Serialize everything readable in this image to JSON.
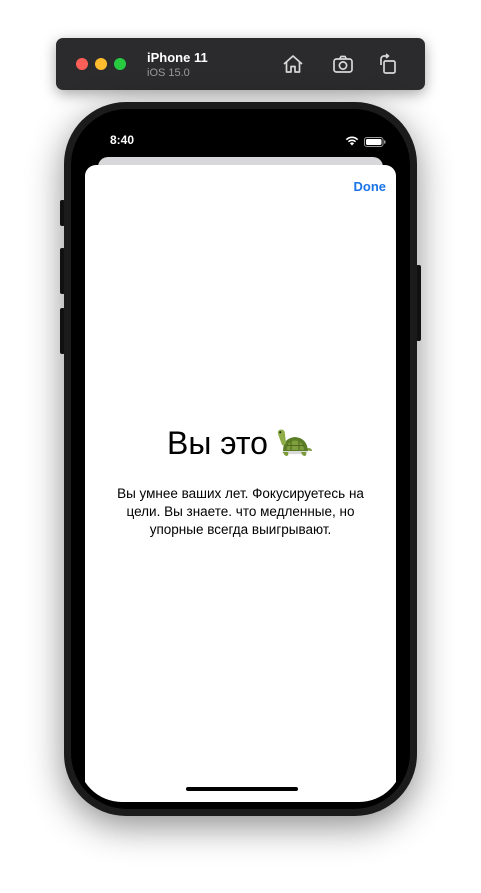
{
  "simulator": {
    "device_name": "iPhone 11",
    "os_version": "iOS 15.0",
    "toolbar_icons": [
      "home-icon",
      "screenshot-icon",
      "rotate-icon"
    ]
  },
  "status_bar": {
    "time": "8:40",
    "icons": [
      "wifi-icon",
      "battery-icon"
    ]
  },
  "sheet": {
    "done_label": "Done",
    "title": "Вы это",
    "title_icon": "turtle-icon",
    "description": "Вы умнее ваших лет. Фокусируетесь на цели. Вы знаете. что медленные, но упорные всегда выигрывают."
  },
  "colors": {
    "accent": "#1a73e8",
    "toolbar_bg": "#2b2b2d",
    "phone_frame": "#1b1b1c"
  }
}
